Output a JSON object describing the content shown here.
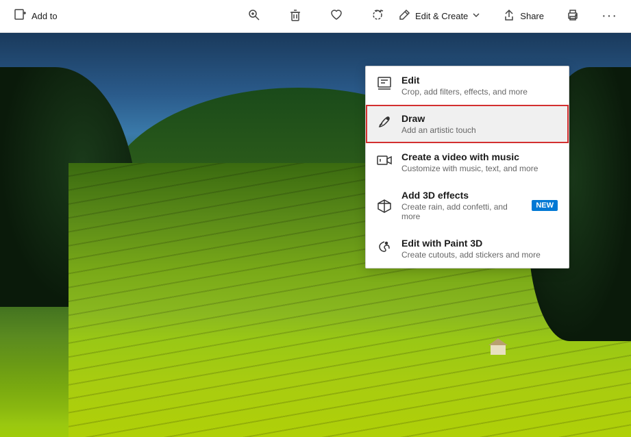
{
  "toolbar": {
    "add_to_label": "Add to",
    "zoom_icon": "zoom-icon",
    "delete_icon": "delete-icon",
    "favorite_icon": "favorite-icon",
    "rotate_icon": "rotate-icon",
    "edit_create_label": "Edit & Create",
    "share_label": "Share",
    "print_icon": "print-icon",
    "more_icon": "more-icon"
  },
  "dropdown": {
    "items": [
      {
        "id": "edit",
        "title": "Edit",
        "description": "Crop, add filters, effects, and more",
        "highlighted": false
      },
      {
        "id": "draw",
        "title": "Draw",
        "description": "Add an artistic touch",
        "highlighted": true
      },
      {
        "id": "video",
        "title": "Create a video with music",
        "description": "Customize with music, text, and more",
        "highlighted": false
      },
      {
        "id": "3d",
        "title": "Add 3D effects",
        "description": "Create rain, add confetti, and more",
        "highlighted": false,
        "badge": "NEW"
      },
      {
        "id": "paint3d",
        "title": "Edit with Paint 3D",
        "description": "Create cutouts, add stickers and more",
        "highlighted": false
      }
    ]
  }
}
